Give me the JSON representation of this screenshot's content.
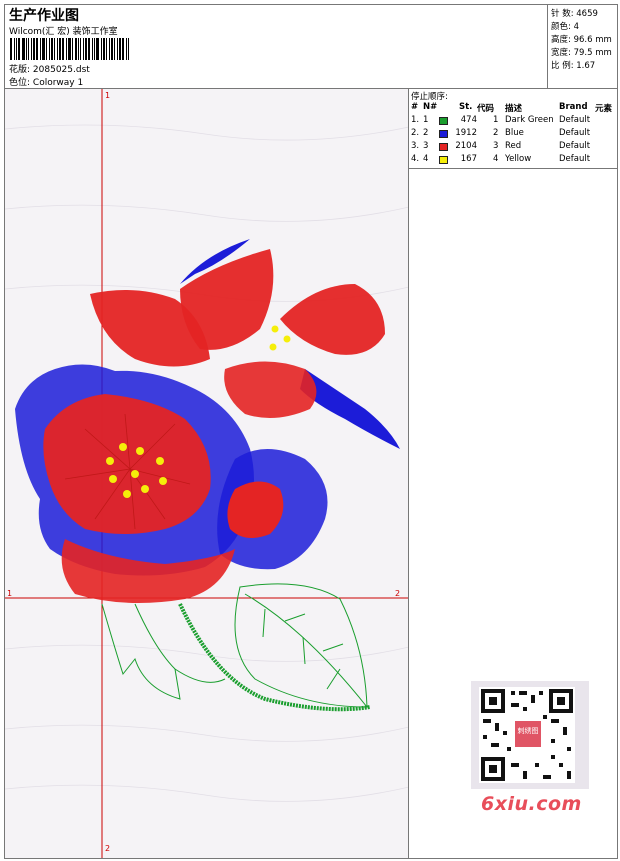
{
  "header": {
    "title": "生产作业图",
    "company": "Wilcom(汇 宏) 装饰工作室",
    "design_label": "花版:",
    "design_value": "2085025.dst",
    "color_label": "色位:",
    "color_value": "Colorway 1"
  },
  "stats": {
    "stitches": "针 数: 4659",
    "colors": "颜色: 4",
    "height": "高度: 96.6 mm",
    "width": "宽度: 79.5 mm",
    "ratio": "比 例: 1.67"
  },
  "stop_sequence": {
    "title": "停止顺序:",
    "headers": {
      "num": "#",
      "no": "N#",
      "st": "St.",
      "code": "代码",
      "desc": "描述",
      "brand": "Brand",
      "element": "元素"
    },
    "rows": [
      {
        "num": "1.",
        "no": "1",
        "color": "#1a9e2e",
        "st": "474",
        "code": "1",
        "desc": "Dark Green",
        "brand": "Default"
      },
      {
        "num": "2.",
        "no": "2",
        "color": "#1c1cd8",
        "st": "1912",
        "code": "2",
        "desc": "Blue",
        "brand": "Default"
      },
      {
        "num": "3.",
        "no": "3",
        "color": "#e42424",
        "st": "2104",
        "code": "3",
        "desc": "Red",
        "brand": "Default"
      },
      {
        "num": "4.",
        "no": "4",
        "color": "#f5ee0a",
        "st": "167",
        "code": "4",
        "desc": "Yellow",
        "brand": "Default"
      }
    ]
  },
  "axes": {
    "top": "1",
    "right": "2",
    "left": "1",
    "bottom": "2"
  },
  "watermark": {
    "logo": "6xiu.com",
    "stamp": "刺绣图"
  },
  "colors": {
    "dark_green": "#1a9e2e",
    "blue": "#1c1cd8",
    "red": "#e42424",
    "yellow": "#f5ee0a",
    "axis": "#cc0000"
  }
}
